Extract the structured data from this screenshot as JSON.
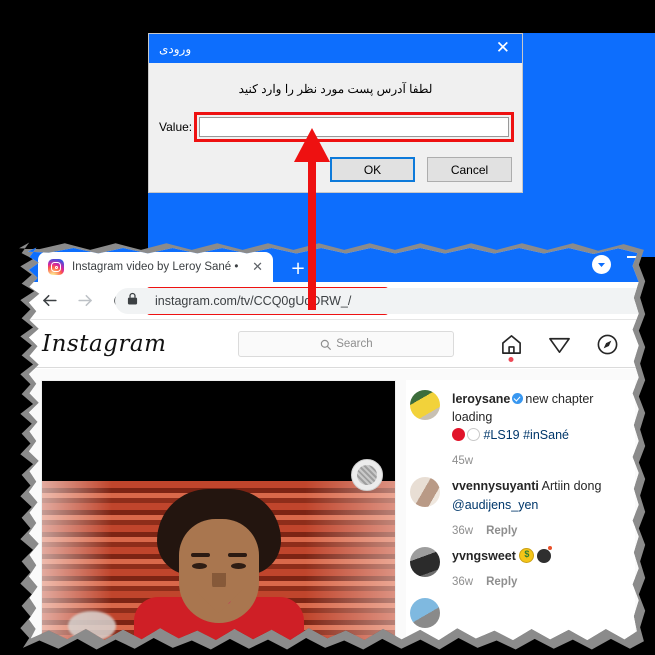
{
  "dialog": {
    "title": "ورودی",
    "close_icon": "close-icon",
    "prompt": "لطفا آدرس پست مورد نظر را وارد کنید",
    "field_label": "Value:",
    "field_value": "",
    "field_placeholder": "",
    "ok_label": "OK",
    "cancel_label": "Cancel",
    "highlight_color": "#ee1111",
    "titlebar_color": "#0d6efd"
  },
  "browser": {
    "tab": {
      "title": "Instagram video by Leroy Sané •",
      "favicon": "instagram-favicon",
      "close_icon": "close-icon"
    },
    "new_tab_label": "+",
    "toolbar": {
      "back_icon": "back-arrow-icon",
      "forward_icon": "forward-arrow-icon",
      "reload_icon": "reload-icon",
      "lock_icon": "lock-icon",
      "url": "instagram.com/tv/CCQ0gUqDRW_/"
    },
    "tab_menu_icon": "chevron-down-icon",
    "minimize_icon": "minimize-icon"
  },
  "instagram": {
    "logo": "Instagram",
    "search_placeholder": "Search",
    "search_icon": "search-icon",
    "nav": [
      {
        "name": "home-icon",
        "badge": true
      },
      {
        "name": "direct-send-icon",
        "badge": false
      },
      {
        "name": "explore-compass-icon",
        "badge": false
      }
    ],
    "comments": [
      {
        "user": "leroysane",
        "verified": true,
        "text": "new chapter loading",
        "emoji": [
          "red-circle-emoji",
          "white-circle-emoji"
        ],
        "hashtags": "#LS19 #inSané",
        "time": "45w",
        "reply": ""
      },
      {
        "user": "vvennysuyanti",
        "verified": false,
        "text": "Artiin dong",
        "mention": "@audijens_yen",
        "time": "36w",
        "reply": "Reply"
      },
      {
        "user": "yvngsweet",
        "verified": false,
        "text": "",
        "emoji": [
          "money-face-emoji",
          "bomb-emoji"
        ],
        "time": "36w",
        "reply": "Reply"
      }
    ]
  },
  "annotation": {
    "arrow_color": "#ee1111",
    "arrow_name": "red-arrow-pointing-to-value-field"
  }
}
